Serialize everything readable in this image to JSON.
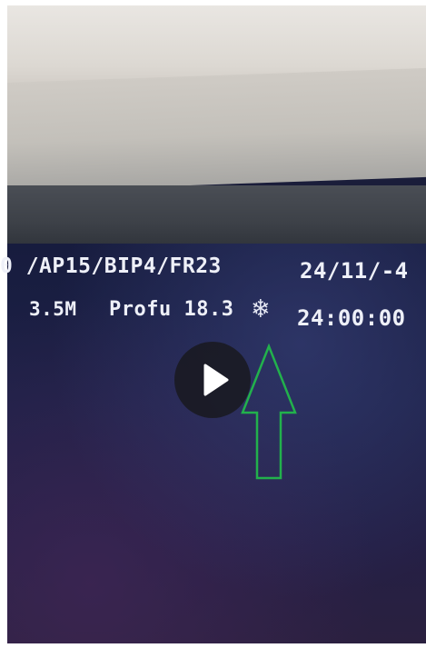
{
  "photo": {
    "osd": {
      "probe_line": "0 /AP15/BIP4/FR23",
      "date": "24/11/-4",
      "depth": "3.5M",
      "profu": "Profu 18.3",
      "freeze_symbol": "❄",
      "time": "24:00:00"
    },
    "overlay": {
      "play_icon": "play-icon",
      "arrow_color": "#22b14c"
    }
  }
}
